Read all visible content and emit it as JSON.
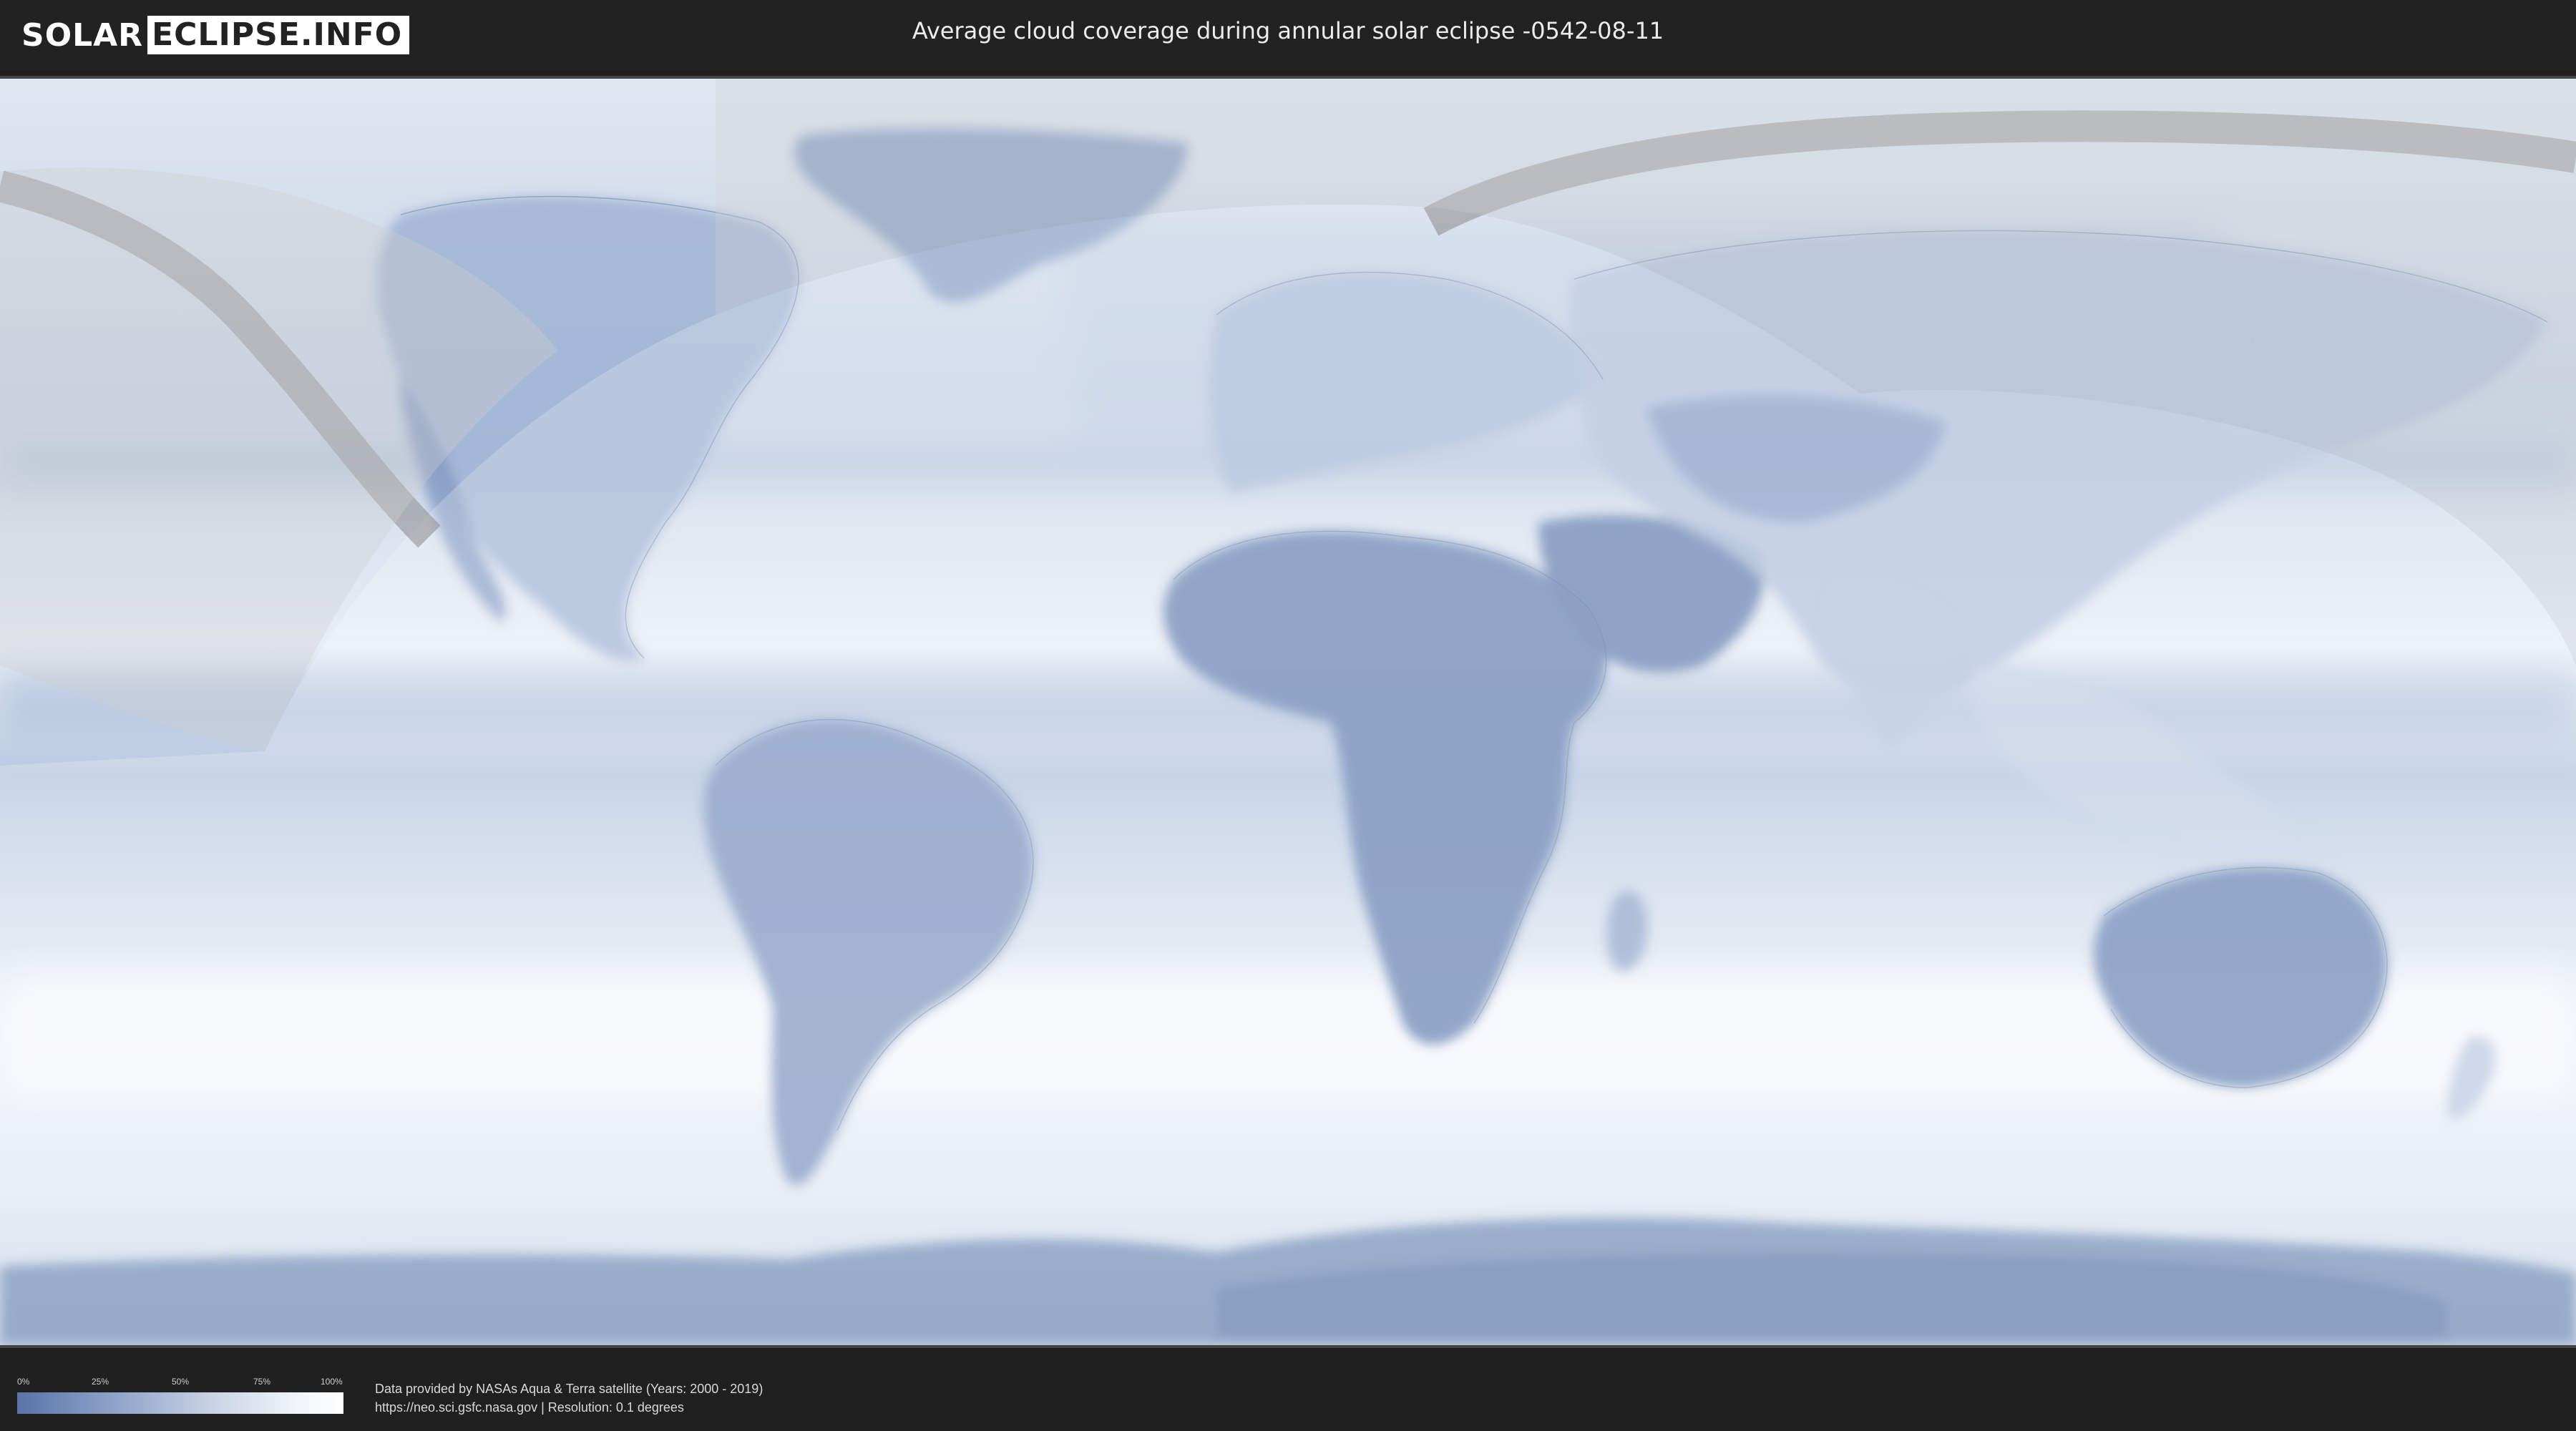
{
  "header": {
    "logo_left": "SOLAR",
    "logo_right": "ECLIPSE.INFO",
    "title": "Average cloud coverage during annular solar eclipse -0542-08-11"
  },
  "legend": {
    "ticks": [
      "0%",
      "25%",
      "50%",
      "75%",
      "100%"
    ]
  },
  "credits": {
    "line1": "Data provided by NASAs Aqua & Terra satellite (Years: 2000 - 2019)",
    "line2": "https://neo.sci.gsfc.nasa.gov | Resolution: 0.1 degrees"
  },
  "colors": {
    "clear": "#4f6c9f",
    "cloudy": "#f4f6fa",
    "path": "#8a8a8a",
    "bars": "#222222"
  }
}
